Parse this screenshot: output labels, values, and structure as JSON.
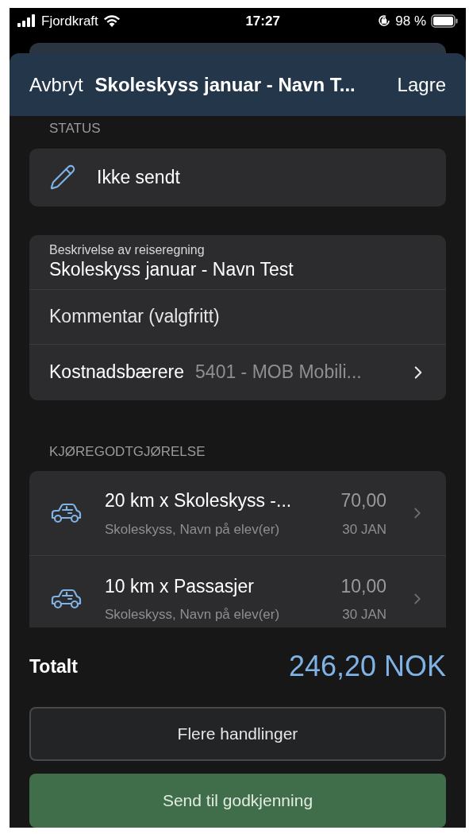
{
  "status_bar": {
    "carrier": "Fjordkraft",
    "time": "17:27",
    "battery": "98 %"
  },
  "nav": {
    "cancel": "Avbryt",
    "title": "Skoleskyss januar - Navn T...",
    "save": "Lagre"
  },
  "status": {
    "header": "STATUS",
    "value": "Ikke sendt"
  },
  "details": [
    {
      "kind": "field",
      "label": "Beskrivelse av reiseregning",
      "value": "Skoleskyss januar - Navn Test"
    },
    {
      "kind": "placeholder",
      "placeholder": "Kommentar (valgfritt)"
    },
    {
      "kind": "picker",
      "label": "Kostnadsbærere",
      "value": "5401 - MOB Mobili..."
    }
  ],
  "mileage": {
    "header": "KJØREGODTGJØRELSE",
    "items": [
      {
        "title": "20 km x Skoleskyss -...",
        "subtitle": "Skoleskyss, Navn på elev(er)",
        "amount": "70,00",
        "date": "30 JAN"
      },
      {
        "title": "10 km x Passasjer",
        "subtitle": "Skoleskyss, Navn på elev(er)",
        "amount": "10,00",
        "date": "30 JAN"
      }
    ]
  },
  "total": {
    "label": "Totalt",
    "amount": "246,20 NOK"
  },
  "buttons": [
    {
      "kind": "secondary",
      "label": "Flere handlinger"
    },
    {
      "kind": "primary",
      "label": "Send til godkjenning"
    }
  ]
}
